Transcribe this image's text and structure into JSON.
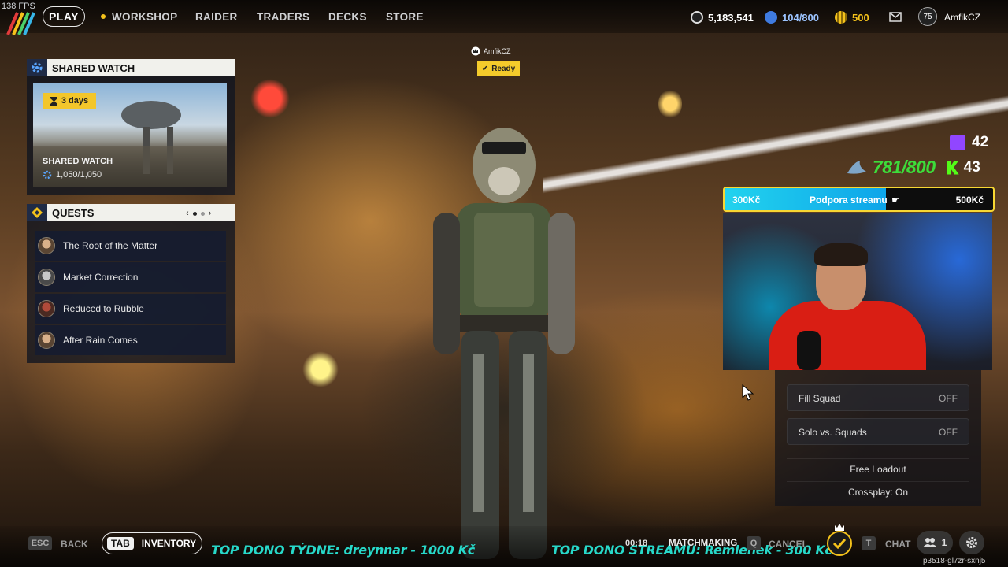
{
  "fps": "138 FPS",
  "nav": {
    "play_label": "PLAY",
    "items": [
      "WORKSHOP",
      "RAIDER",
      "TRADERS",
      "DECKS",
      "STORE"
    ]
  },
  "resources": {
    "coins": "5,183,541",
    "stash": "104/800",
    "tokens": "500",
    "level": "75",
    "username": "AmfikCZ"
  },
  "shared_watch": {
    "header": "SHARED WATCH",
    "days_left": "3 days",
    "card_title": "SHARED WATCH",
    "progress": "1,050/1,050"
  },
  "quests": {
    "header": "QUESTS",
    "items": [
      "The Root of the Matter",
      "Market Correction",
      "Reduced to Rubble",
      "After Rain Comes"
    ]
  },
  "player": {
    "name": "AmfikCZ",
    "status": "Ready"
  },
  "stream": {
    "twitch_viewers": "42",
    "sub_goal": "781/800",
    "kick_viewers": "43",
    "donate": {
      "left": "300Kč",
      "title": "Podpora streamu",
      "right": "500Kč",
      "fraction": 0.6
    }
  },
  "matchmaking_options": {
    "fill_squad": {
      "label": "Fill Squad",
      "value": "OFF"
    },
    "solo_vs_squads": {
      "label": "Solo vs. Squads",
      "value": "OFF"
    },
    "free_loadout": "Free Loadout",
    "crossplay": "Crossplay: On"
  },
  "bottom": {
    "esc_key": "ESC",
    "back_label": "BACK",
    "tab_key": "TAB",
    "inventory_label": "INVENTORY",
    "dono_week": "TOP DONO TÝDNE:  dreynnar - 1000 Kč",
    "dono_stream": "TOP DONO STREAMU: Remienek - 300 Kč",
    "mm_time": "00:18",
    "mm_label": "MATCHMAKING",
    "q_key": "Q",
    "cancel_label": "CANCEL",
    "t_key": "T",
    "chat_label": "CHAT",
    "squad_count": "1",
    "session_id": "p3518-gl7zr-sxnj5"
  },
  "colors": {
    "accent_yellow": "#f4c21b",
    "kick_green": "#53fc18",
    "twitch_purple": "#9146ff",
    "dono_cyan": "#27d8c9"
  }
}
